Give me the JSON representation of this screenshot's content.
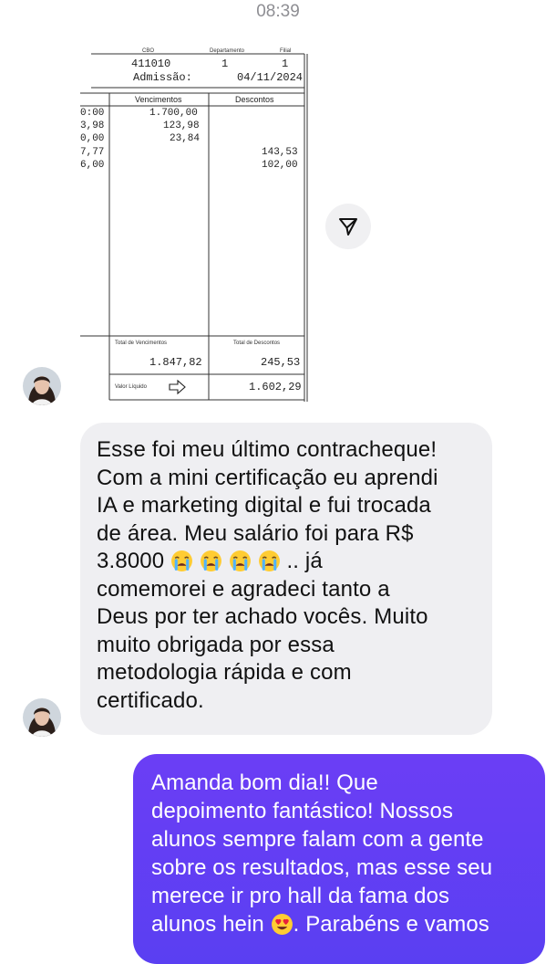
{
  "status": {
    "time": "08:39"
  },
  "receipt": {
    "header_labels": {
      "cbo": "CBO",
      "departamento": "Departamento",
      "filial": "Filial"
    },
    "cbo": "411010",
    "departamento": "1",
    "filial": "1",
    "admissao_label": "Admissão:",
    "admissao_date": "04/11/2024",
    "col_vencimentos": "Vencimentos",
    "col_descontos": "Descontos",
    "ref_values": [
      "0:00",
      "3,98",
      "0,00",
      "7,77",
      "6,00"
    ],
    "vencimentos": [
      "1.700,00",
      "123,98",
      "23,84"
    ],
    "descontos": [
      "143,53",
      "102,00"
    ],
    "total_vencimentos_label": "Total de Vencimentos",
    "total_descontos_label": "Total de Descontos",
    "total_vencimentos": "1.847,82",
    "total_descontos": "245,53",
    "valor_liquido_label": "Valor Líquido",
    "valor_liquido": "1.602,29"
  },
  "messages": {
    "incoming": {
      "line1": "Esse foi meu último contracheque!",
      "line2": "Com a mini certificação eu aprendi",
      "line3": "IA e marketing digital e fui trocada",
      "line4": "de área. Meu salário foi para R$",
      "line5_start": "3.8000",
      "line5_end": ".. já",
      "line6": "comemorei e agradeci tanto a",
      "line7": "Deus por ter achado vocês. Muito",
      "line8": "muito obrigada por essa",
      "line9": "metodologia rápida e com",
      "line10": "certificado."
    },
    "outgoing": {
      "line1": "Amanda bom dia!! Que",
      "line2": "depoimento fantástico! Nossos",
      "line3": "alunos sempre falam com a gente",
      "line4": "sobre os resultados, mas esse seu",
      "line5": "merece ir pro hall da fama dos",
      "line6_start": "alunos hein",
      "line6_end": ". Parabéns e vamos"
    }
  },
  "icons": {
    "send": "paper-plane-icon",
    "crying": "crying-face-emoji",
    "heart_eyes": "heart-eyes-emoji"
  },
  "colors": {
    "outgoing_bubble": "#5a3ff2",
    "incoming_bubble": "#efeff2",
    "time_text": "#8e8e93"
  }
}
